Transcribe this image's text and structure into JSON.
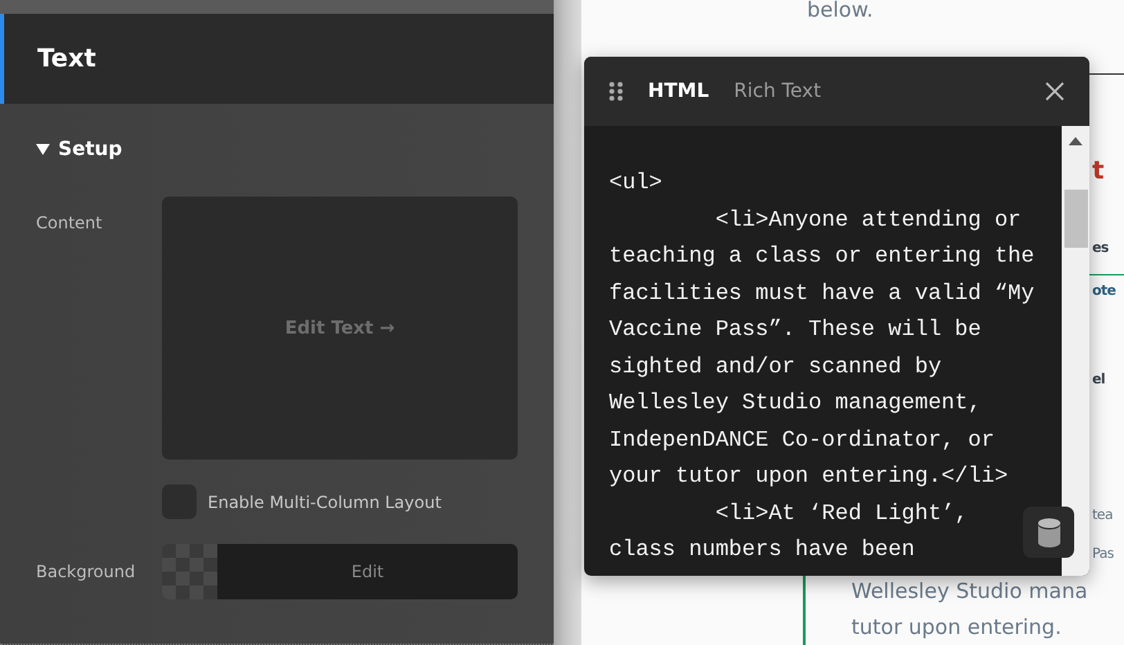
{
  "editor_panel": {
    "title": "Text",
    "section": {
      "title": "Setup",
      "expanded": true
    },
    "content_label": "Content",
    "edit_text_button": "Edit Text →",
    "multi_column": {
      "label": "Enable Multi-Column Layout",
      "checked": false
    },
    "background_label": "Background",
    "background_edit_button": "Edit"
  },
  "page": {
    "top_text": "below.",
    "side_fragments": [
      {
        "text": "t",
        "kind": "heading"
      },
      {
        "text": "es",
        "kind": "strong"
      },
      {
        "text": "ote",
        "kind": "link"
      },
      {
        "text": "el",
        "kind": "strong"
      },
      {
        "text": "tea",
        "kind": "plain"
      },
      {
        "text": "Pas",
        "kind": "plain"
      }
    ],
    "quote_lines": [
      "Wellesley Studio mana",
      "tutor upon entering."
    ]
  },
  "html_window": {
    "tabs": [
      {
        "label": "HTML",
        "selected": true
      },
      {
        "label": "Rich Text",
        "selected": false
      }
    ],
    "code": "<ul>\n\t<li>Anyone attending or teaching a class or entering the facilities must have a valid “My Vaccine Pass”. These will be sighted and/or scanned by Wellesley Studio management, IndepenDANCE Co-ordinator, or your tutor upon entering.</li>\n\t<li>At ‘Red Light’, class numbers have been"
  }
}
